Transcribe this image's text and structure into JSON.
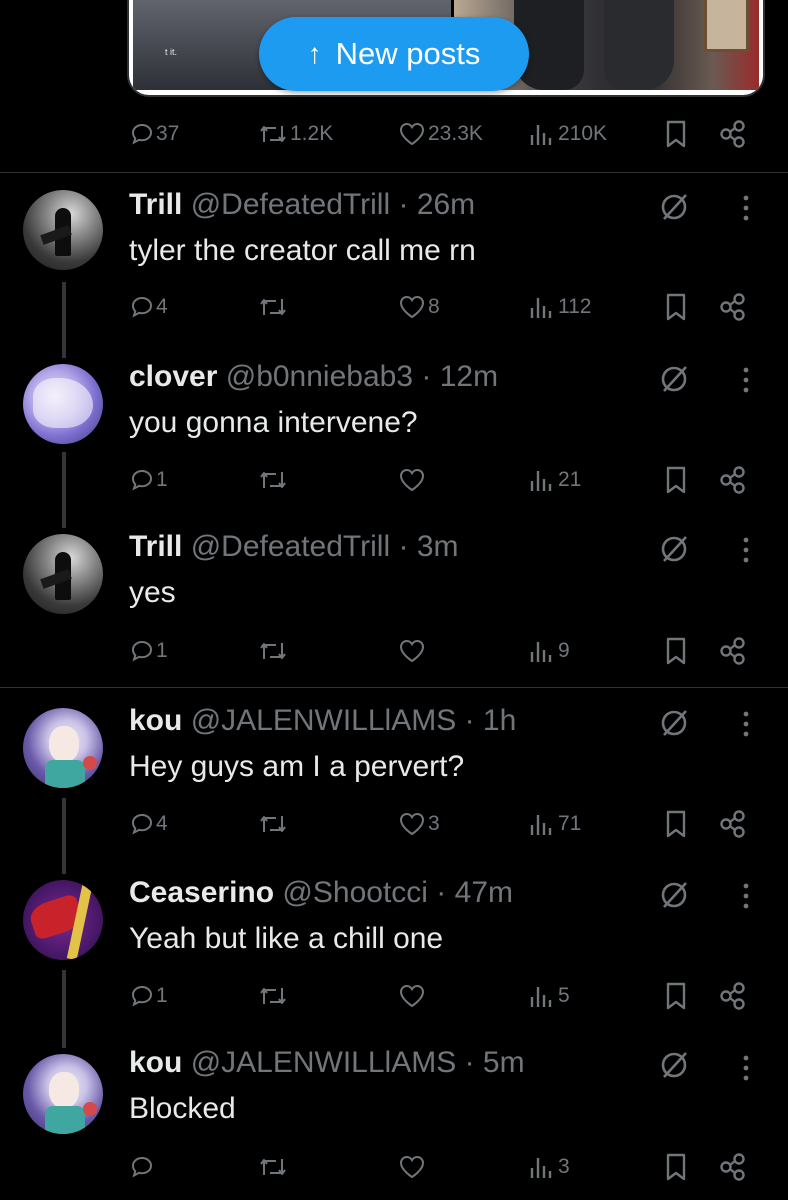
{
  "banner": {
    "new_posts_label": "New posts",
    "media_caption": "t it."
  },
  "top_actions": {
    "replies": "37",
    "reposts": "1.2K",
    "likes": "23.3K",
    "views": "210K"
  },
  "tweets": [
    {
      "name": "Trill",
      "handle": "@DefeatedTrill",
      "sep": "·",
      "time": "26m",
      "text": "tyler the creator call me rn",
      "replies": "4",
      "reposts": "",
      "likes": "8",
      "views": "112"
    },
    {
      "name": "clover",
      "handle": "@b0nniebab3",
      "sep": "·",
      "time": "12m",
      "text": "you gonna intervene?",
      "replies": "1",
      "reposts": "",
      "likes": "",
      "views": "21"
    },
    {
      "name": "Trill",
      "handle": "@DefeatedTrill",
      "sep": "·",
      "time": "3m",
      "text": "yes",
      "replies": "1",
      "reposts": "",
      "likes": "",
      "views": "9"
    },
    {
      "name": "kou",
      "handle": "@JALENWILLlAMS",
      "sep": "·",
      "time": "1h",
      "text": "Hey guys am I a pervert?",
      "replies": "4",
      "reposts": "",
      "likes": "3",
      "views": "71"
    },
    {
      "name": "Ceaserino",
      "handle": "@Shootcci",
      "sep": "·",
      "time": "47m",
      "text": "Yeah but like a chill one",
      "replies": "1",
      "reposts": "",
      "likes": "",
      "views": "5"
    },
    {
      "name": "kou",
      "handle": "@JALENWILLlAMS",
      "sep": "·",
      "time": "5m",
      "text": "Blocked",
      "replies": "",
      "reposts": "",
      "likes": "",
      "views": "3"
    }
  ],
  "icons": {
    "reply": "reply-icon",
    "repost": "repost-icon",
    "like": "like-icon",
    "views": "views-icon",
    "bookmark": "bookmark-icon",
    "share": "share-icon",
    "grok": "grok-icon",
    "more": "more-icon"
  },
  "colors": {
    "background": "#000000",
    "text": "#e7e9ea",
    "muted": "#71767b",
    "accent": "#1d9bf0",
    "divider": "#2f3336"
  }
}
